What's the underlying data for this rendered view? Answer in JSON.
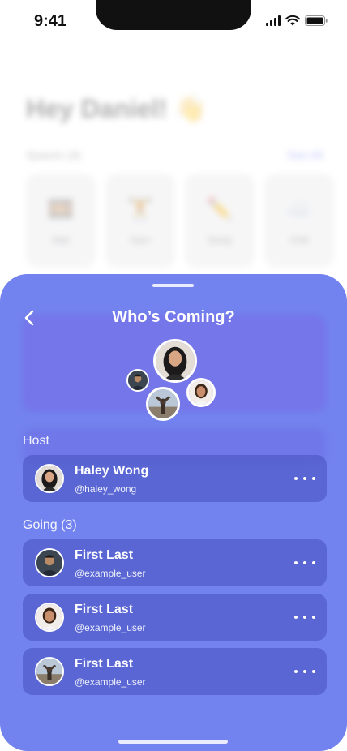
{
  "status_bar": {
    "time": "9:41"
  },
  "background": {
    "greeting": "Hey Daniel! 👋",
    "section_title": "Spaces (4)",
    "see_all": "See All",
    "cards": [
      {
        "emoji": "🎞️",
        "label": "Ball"
      },
      {
        "emoji": "🏋️",
        "label": "Gym"
      },
      {
        "emoji": "✏️",
        "label": "Study"
      },
      {
        "emoji": "☁️",
        "label": "Chill"
      }
    ]
  },
  "sheet": {
    "title": "Who’s Coming?",
    "host_label": "Host",
    "host": {
      "name": "Haley Wong",
      "handle": "@haley_wong"
    },
    "going_label": "Going (3)",
    "going": [
      {
        "name": "First Last",
        "handle": "@example_user"
      },
      {
        "name": "First Last",
        "handle": "@example_user"
      },
      {
        "name": "First Last",
        "handle": "@example_user"
      }
    ]
  },
  "colors": {
    "sheet": "#7282ee",
    "row": "#5a63cf",
    "text": "#ffffff"
  }
}
